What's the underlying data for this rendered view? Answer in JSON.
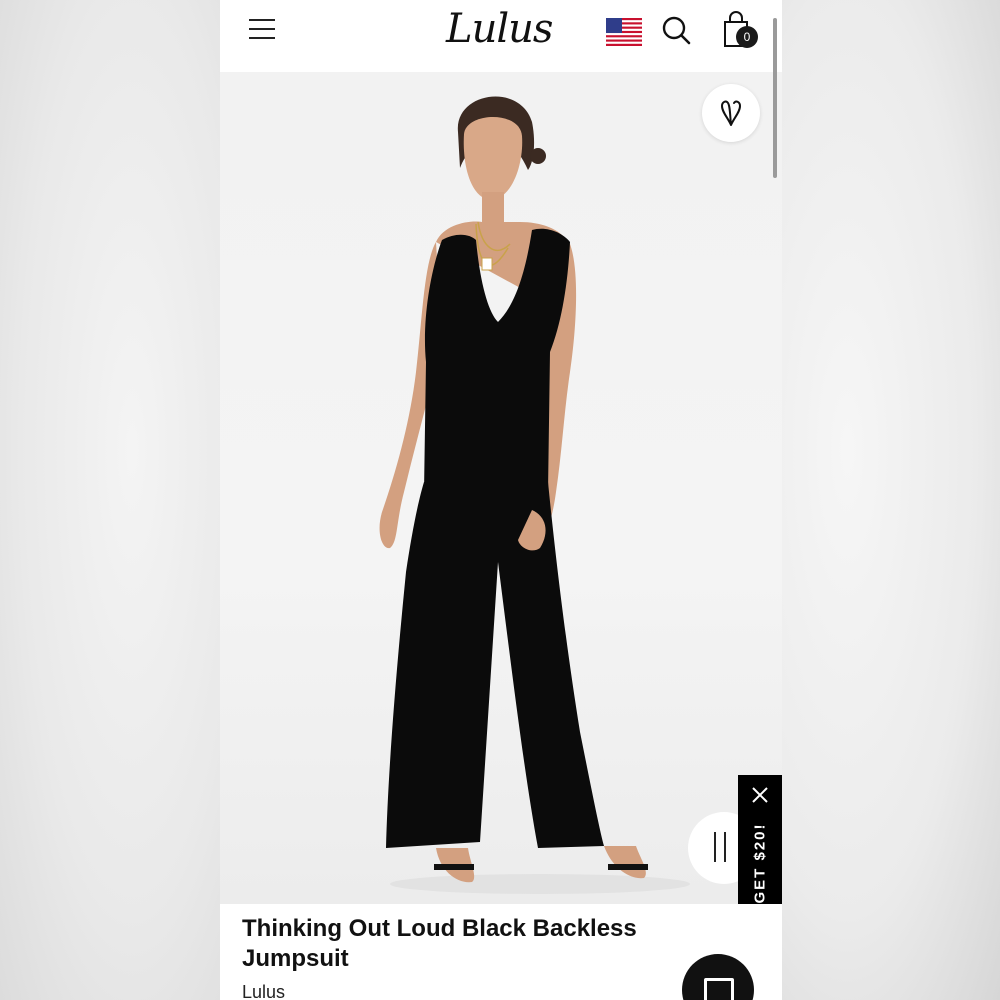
{
  "header": {
    "logo_text": "Lulus",
    "cart_count": "0",
    "icons": {
      "menu": "hamburger-menu-icon",
      "flag": "us-flag-icon",
      "search": "search-icon",
      "cart": "shopping-bag-icon"
    }
  },
  "media": {
    "wishlist_icon": "heart-v-icon",
    "pause_icon": "pause-icon"
  },
  "promo": {
    "label": "GET $20!",
    "close_icon": "close-icon"
  },
  "product": {
    "title": "Thinking Out Loud Black Backless Jumpsuit",
    "brand": "Lulus"
  },
  "chat": {
    "icon": "chat-icon"
  },
  "colors": {
    "text": "#111111",
    "background": "#ffffff",
    "promo_bg": "#000000",
    "flag_red": "#c8102e",
    "flag_blue": "#2f3d8a"
  }
}
